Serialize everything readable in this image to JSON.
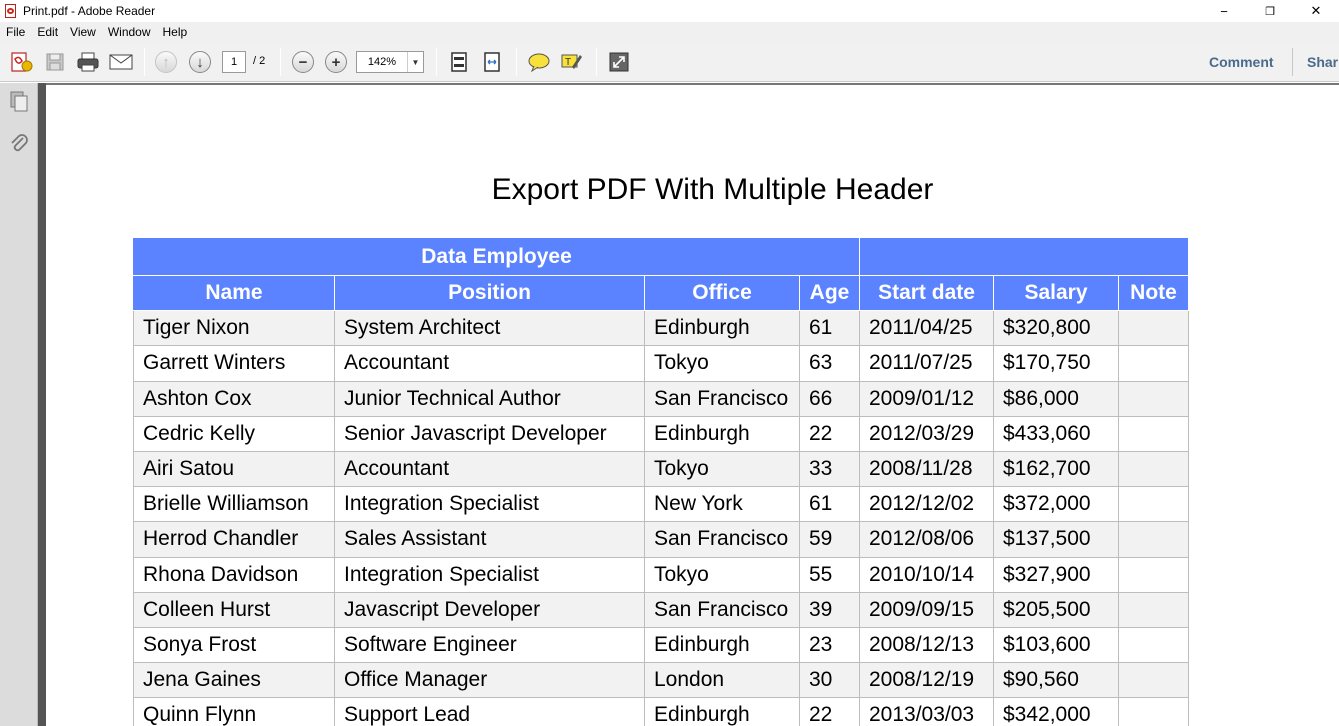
{
  "window": {
    "title": "Print.pdf - Adobe Reader",
    "minimize": "−",
    "restore": "❐",
    "close": "✕"
  },
  "menu": [
    "File",
    "Edit",
    "View",
    "Window",
    "Help"
  ],
  "toolbar": {
    "page_current": "1",
    "page_total": "/ 2",
    "zoom": "142%",
    "comment_label": "Comment",
    "share_label": "Shar"
  },
  "document": {
    "title": "Export PDF With Multiple Header",
    "group_header": "Data Employee",
    "columns": [
      "Name",
      "Position",
      "Office",
      "Age",
      "Start date",
      "Salary",
      "Note"
    ],
    "rows": [
      [
        "Tiger Nixon",
        "System Architect",
        "Edinburgh",
        "61",
        "2011/04/25",
        "$320,800",
        ""
      ],
      [
        "Garrett Winters",
        "Accountant",
        "Tokyo",
        "63",
        "2011/07/25",
        "$170,750",
        ""
      ],
      [
        "Ashton Cox",
        "Junior Technical Author",
        "San Francisco",
        "66",
        "2009/01/12",
        "$86,000",
        ""
      ],
      [
        "Cedric Kelly",
        "Senior Javascript Developer",
        "Edinburgh",
        "22",
        "2012/03/29",
        "$433,060",
        ""
      ],
      [
        "Airi Satou",
        "Accountant",
        "Tokyo",
        "33",
        "2008/11/28",
        "$162,700",
        ""
      ],
      [
        "Brielle Williamson",
        "Integration Specialist",
        "New York",
        "61",
        "2012/12/02",
        "$372,000",
        ""
      ],
      [
        "Herrod Chandler",
        "Sales Assistant",
        "San Francisco",
        "59",
        "2012/08/06",
        "$137,500",
        ""
      ],
      [
        "Rhona Davidson",
        "Integration Specialist",
        "Tokyo",
        "55",
        "2010/10/14",
        "$327,900",
        ""
      ],
      [
        "Colleen Hurst",
        "Javascript Developer",
        "San Francisco",
        "39",
        "2009/09/15",
        "$205,500",
        ""
      ],
      [
        "Sonya Frost",
        "Software Engineer",
        "Edinburgh",
        "23",
        "2008/12/13",
        "$103,600",
        ""
      ],
      [
        "Jena Gaines",
        "Office Manager",
        "London",
        "30",
        "2008/12/19",
        "$90,560",
        ""
      ],
      [
        "Quinn Flynn",
        "Support Lead",
        "Edinburgh",
        "22",
        "2013/03/03",
        "$342,000",
        ""
      ]
    ]
  },
  "colors": {
    "header_bg": "#5b83ff",
    "row_alt": "#f2f2f2",
    "toolbar_link": "#4b6a8c"
  }
}
